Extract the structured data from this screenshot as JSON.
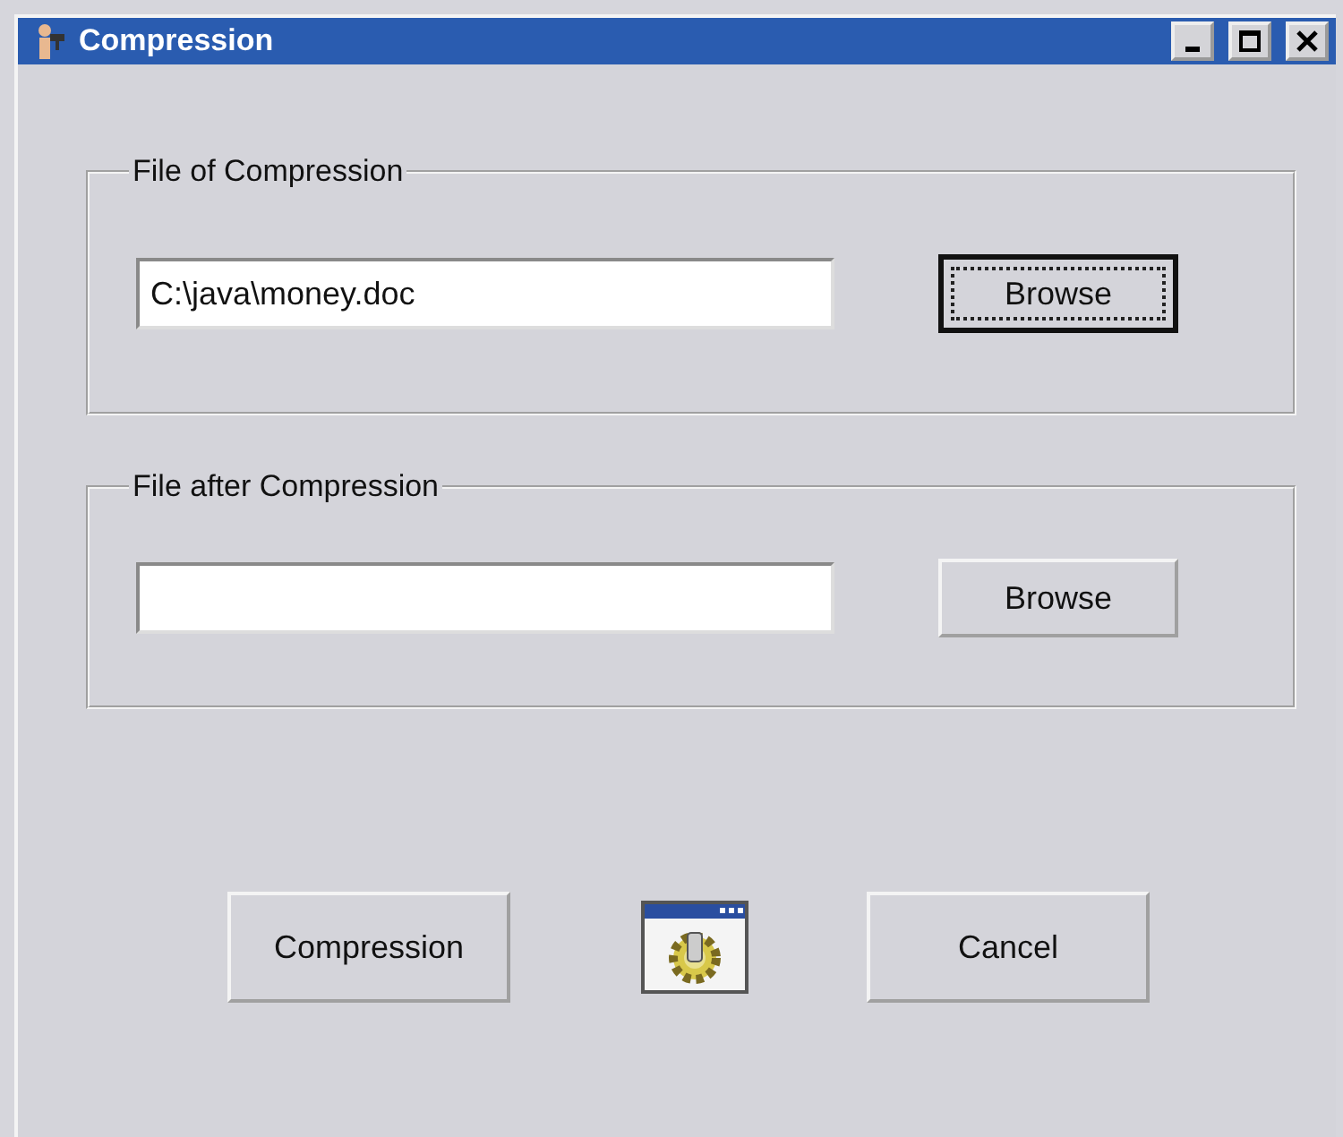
{
  "window": {
    "title": "Compression"
  },
  "groups": [
    {
      "label": "File of Compression",
      "value": "C:\\java\\money.doc",
      "button": {
        "label": "Browse",
        "focused": true
      }
    },
    {
      "label": "File after Compression",
      "button": {
        "label": "Browse",
        "focused": false
      }
    }
  ],
  "buttons": [
    {
      "label": "Compression",
      "kind": "button"
    },
    {
      "kind": "icon"
    },
    {
      "label": "Cancel",
      "kind": "button"
    }
  ]
}
